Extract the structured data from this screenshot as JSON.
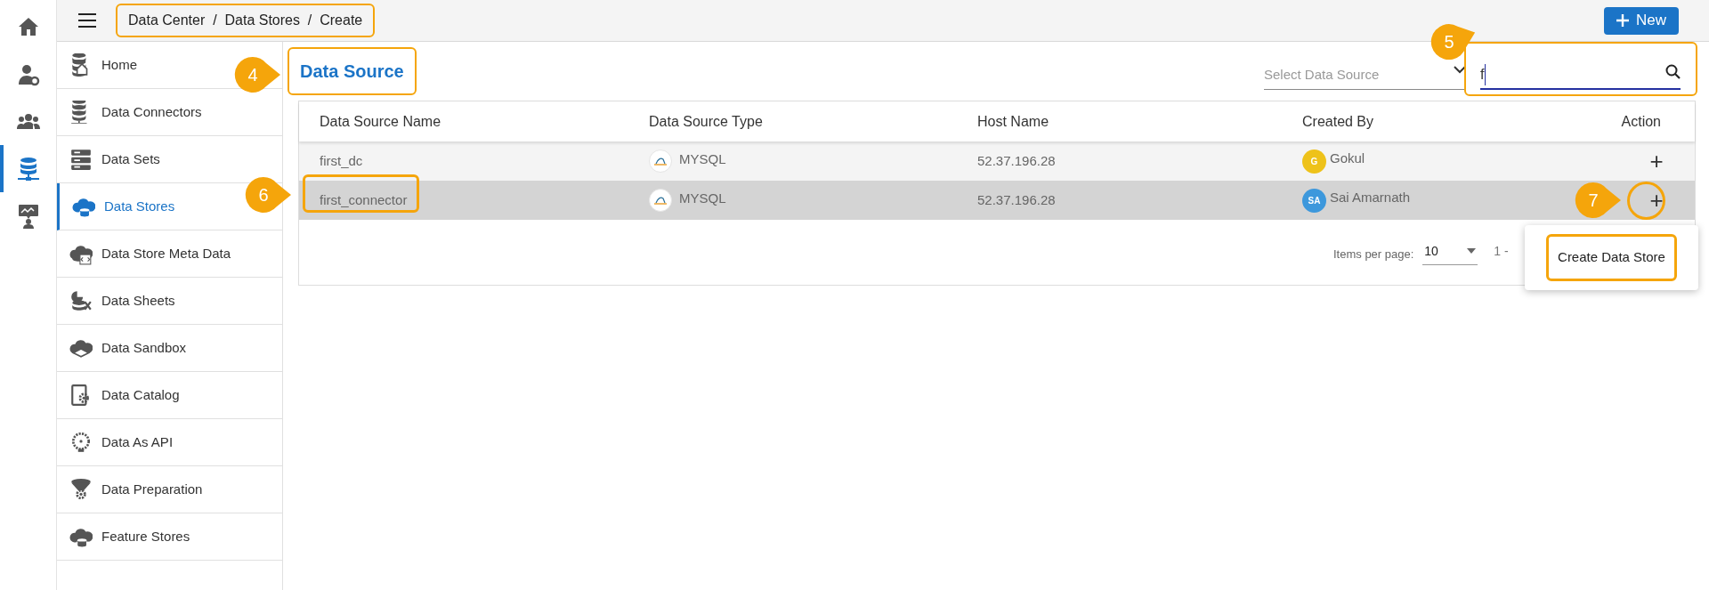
{
  "rail": [
    {
      "kind": "home",
      "selected": false
    },
    {
      "kind": "user-gear",
      "selected": false
    },
    {
      "kind": "group",
      "selected": false
    },
    {
      "kind": "database-network",
      "selected": true
    },
    {
      "kind": "presenter",
      "selected": false
    }
  ],
  "top_bar": {
    "breadcrumb": "Data Center  /  Data Stores  /  Create",
    "breadcrumb_highlighted": true,
    "new_button": "New"
  },
  "sidebar": {
    "items": [
      {
        "label": "Home",
        "kind": "db-home",
        "selected": false
      },
      {
        "label": "Data Connectors",
        "kind": "db-network",
        "selected": false
      },
      {
        "label": "Data Sets",
        "kind": "server",
        "selected": false
      },
      {
        "label": "Data Stores",
        "kind": "cloud-db",
        "selected": true
      },
      {
        "label": "Data Store Meta Data",
        "kind": "db-code",
        "selected": false
      },
      {
        "label": "Data Sheets",
        "kind": "pie-db",
        "selected": false
      },
      {
        "label": "Data Sandbox",
        "kind": "cloud-box",
        "selected": false
      },
      {
        "label": "Data Catalog",
        "kind": "doc-gear",
        "selected": false
      },
      {
        "label": "Data As API",
        "kind": "gear-db",
        "selected": false
      },
      {
        "label": "Data Preparation",
        "kind": "funnel-gear",
        "selected": false
      },
      {
        "label": "Feature Stores",
        "kind": "cloud-db",
        "selected": false
      }
    ]
  },
  "page_title": "Data Source",
  "source_select": {
    "placeholder": "Select Data Source"
  },
  "search": {
    "value": "f"
  },
  "table": {
    "columns": [
      "Data Source Name",
      "Data Source Type",
      "Host Name",
      "Created By",
      "Action"
    ],
    "rows": [
      {
        "name": "first_dc",
        "type": "MYSQL",
        "host": "52.37.196.28",
        "creator": {
          "initials": "G",
          "name": "Gokul",
          "color": "#eec21a"
        },
        "action": "+",
        "selected": false
      },
      {
        "name": "first_connector",
        "type": "MYSQL",
        "host": "52.37.196.28",
        "creator": {
          "initials": "SA",
          "name": "Sai Amarnath",
          "color": "#3d98dc"
        },
        "action": "+",
        "selected": true
      }
    ]
  },
  "pagination": {
    "label": "Items per page:",
    "value": "10",
    "range": "1 -"
  },
  "popup": {
    "item": "Create Data Store"
  },
  "callouts": {
    "title": "4",
    "search": "5",
    "row": "6",
    "action": "7"
  }
}
